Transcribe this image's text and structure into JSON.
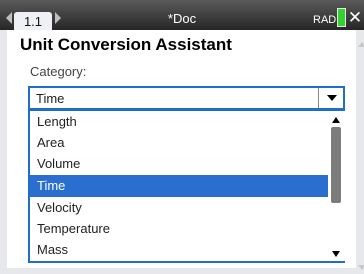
{
  "statusbar": {
    "tab_label": "1.1",
    "doc_title": "*Doc",
    "angle_mode": "RAD",
    "battery_color": "#34d22f"
  },
  "dialog": {
    "title": "Unit Conversion Assistant",
    "category_label": "Category:",
    "selected_value": "Time",
    "options": [
      "Length",
      "Area",
      "Volume",
      "Time",
      "Velocity",
      "Temperature",
      "Mass"
    ],
    "selected_index": 3,
    "accent_color": "#2a6fd0"
  },
  "icons": {
    "prev": "chevron-left-icon",
    "next": "chevron-right-icon",
    "battery": "battery-icon",
    "close": "close-icon",
    "dropdown": "caret-down-icon",
    "scroll_up": "scroll-up-icon",
    "scroll_down": "scroll-down-icon"
  }
}
